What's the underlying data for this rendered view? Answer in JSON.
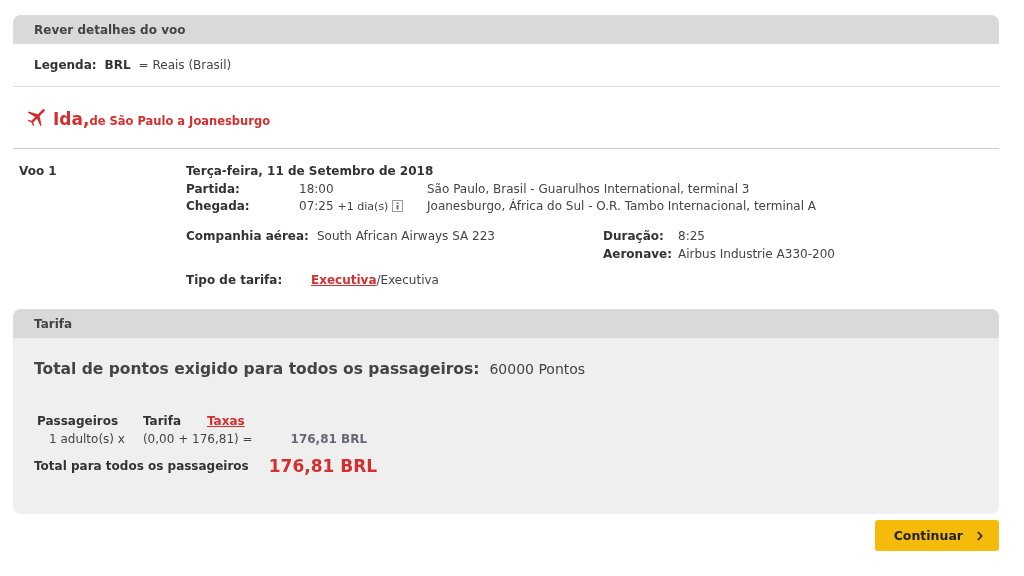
{
  "review_panel": {
    "title": "Rever detalhes do voo",
    "legend": {
      "label": "Legenda:",
      "code": "BRL",
      "meaning": "= Reais (Brasil)"
    },
    "direction": {
      "title": "Ida,",
      "route": "de São Paulo a Joanesburgo"
    },
    "flight": {
      "name": "Voo 1",
      "date": "Terça-feira, 11 de Setembro de 2018",
      "segments": [
        {
          "label": "Partida:",
          "time": "18:00",
          "place": "São Paulo, Brasil - Guarulhos International, terminal 3"
        },
        {
          "label": "Chegada:",
          "time": "07:25",
          "day_offset": "+1 dia(s)",
          "place": "Joanesburgo, África do Sul - O.R. Tambo Internacional, terminal A"
        }
      ],
      "airline": {
        "label": "Companhia aérea:",
        "value": "South African Airways SA 223"
      },
      "details": [
        {
          "label": "Duração:",
          "value": "8:25"
        },
        {
          "label": "Aeronave:",
          "value": "Airbus Industrie A330-200"
        }
      ],
      "fare_type": {
        "label": "Tipo de tarifa:",
        "link": "Executiva",
        "rest": "/Executiva"
      }
    }
  },
  "fare_panel": {
    "title": "Tarifa",
    "points": {
      "label": "Total de pontos exigido para todos os passageiros:",
      "value": "60000 Pontos"
    },
    "columns": [
      {
        "label": "Passageiros",
        "link": false
      },
      {
        "label": "Tarifa",
        "link": false
      },
      {
        "label": "Taxas",
        "link": true
      }
    ],
    "row": {
      "passengers": "1 adulto(s) x",
      "formula": "(0,00 + 176,81) =",
      "amount": "176,81 BRL"
    },
    "total": {
      "label": "Total para todos os passageiros",
      "value": "176,81 BRL"
    }
  },
  "continue_button": "Continuar"
}
